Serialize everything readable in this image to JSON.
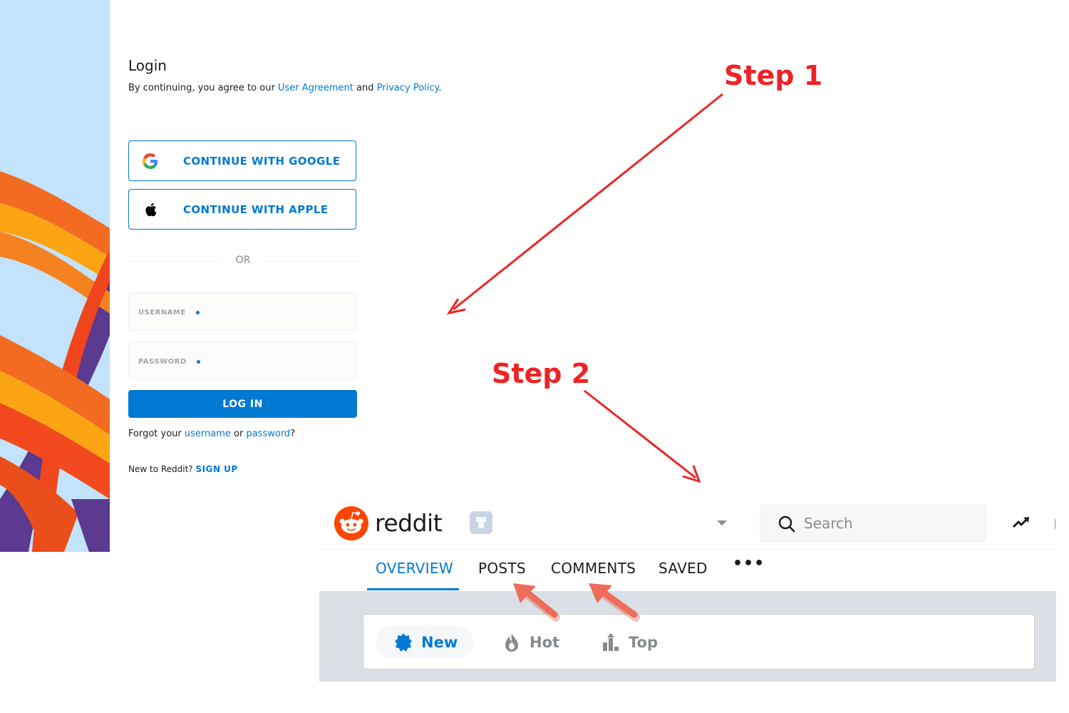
{
  "login": {
    "title": "Login",
    "legal_prefix": "By continuing, you agree to our ",
    "user_agreement_link": "User Agreement",
    "legal_and": " and ",
    "privacy_policy_link": "Privacy Policy",
    "legal_suffix": ".",
    "google_button_label": "CONTINUE WITH GOOGLE",
    "apple_button_label": "CONTINUE WITH APPLE",
    "or_label": "OR",
    "username_placeholder": "USERNAME",
    "password_placeholder": "PASSWORD",
    "login_button_label": "LOG IN",
    "forgot_prefix": "Forgot your ",
    "forgot_username_link": "username",
    "forgot_or": " or ",
    "forgot_password_link": "password",
    "forgot_suffix": "?",
    "new_to_reddit": "New to Reddit? ",
    "signup_link": "SIGN UP"
  },
  "annotations": {
    "step1": "Step 1",
    "step2": "Step 2",
    "color": "#ee2326",
    "callout_arrow_color": "#ef6b5a"
  },
  "reddit": {
    "wordmark": "reddit",
    "brand_color": "#ff4500",
    "search_placeholder": "Search",
    "tabs": [
      {
        "label": "OVERVIEW",
        "active": true
      },
      {
        "label": "POSTS",
        "active": false
      },
      {
        "label": "COMMENTS",
        "active": false
      },
      {
        "label": "SAVED",
        "active": false
      },
      {
        "label": "•••",
        "active": false
      }
    ],
    "sort": [
      {
        "label": "New",
        "icon": "new-badge-icon",
        "active": true
      },
      {
        "label": "Hot",
        "icon": "flame-icon",
        "active": false
      },
      {
        "label": "Top",
        "icon": "top-bars-icon",
        "active": false
      }
    ]
  },
  "colors": {
    "accent": "#0079d3",
    "feed_background": "#dae0e6"
  }
}
